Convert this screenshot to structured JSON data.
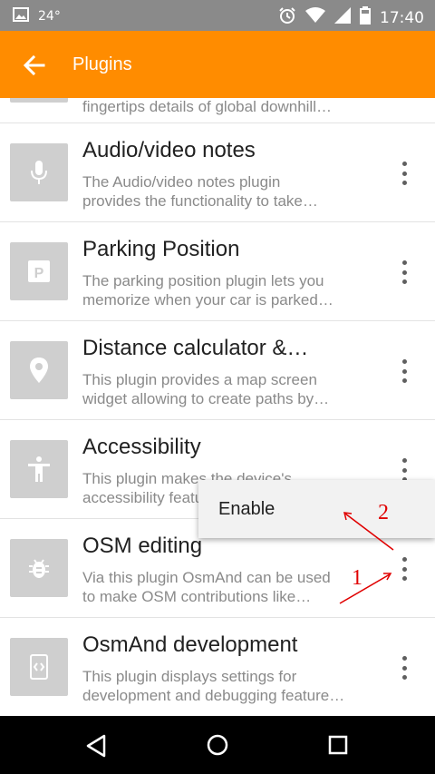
{
  "status_bar": {
    "temperature": "24°",
    "time": "17:40"
  },
  "app_bar": {
    "title": "Plugins"
  },
  "plugins": [
    {
      "name": "",
      "description_lines": [
        "fingertips details of global downhill…"
      ],
      "icon": "ski-icon"
    },
    {
      "name": "Audio/video notes",
      "description_lines": [
        "The Audio/video notes plugin",
        "provides the functionality to take…"
      ],
      "icon": "microphone-icon"
    },
    {
      "name": "Parking Position",
      "description_lines": [
        "The parking position plugin lets you",
        "memorize when your car is parked…"
      ],
      "icon": "parking-icon"
    },
    {
      "name": "Distance calculator &…",
      "description_lines": [
        "This plugin provides a map screen",
        "widget allowing to create paths by…"
      ],
      "icon": "map-pin-icon"
    },
    {
      "name": "Accessibility",
      "description_lines": [
        "This plugin makes the device's",
        "accessibility features…"
      ],
      "icon": "accessibility-icon"
    },
    {
      "name": "OSM editing",
      "description_lines": [
        "Via this plugin OsmAnd can be used",
        "to make OSM contributions like…"
      ],
      "icon": "bug-icon"
    },
    {
      "name": "OsmAnd development",
      "description_lines": [
        "This plugin displays settings for",
        "development and debugging feature…"
      ],
      "icon": "code-icon"
    }
  ],
  "context_menu": {
    "option": "Enable"
  },
  "annotations": {
    "step1": "1",
    "step2": "2",
    "color": "#e00000"
  },
  "colors": {
    "accent": "#ff8c00",
    "status_bar": "#8a8a8a"
  }
}
